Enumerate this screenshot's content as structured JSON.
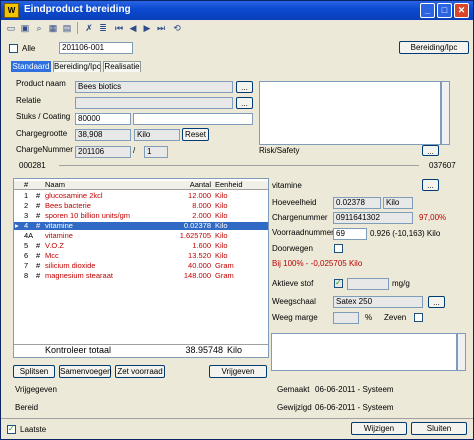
{
  "window": {
    "title": "Eindproduct bereiding"
  },
  "top": {
    "alle_label": "Alle",
    "batch_code": "201106-001",
    "bereiding_button": "Bereiding/Ipc"
  },
  "tabs": [
    "Standaard",
    "Bereiding/Ipc",
    "Realisatie"
  ],
  "form": {
    "product_label": "Product naam",
    "product_value": "Bees biotics",
    "relatie_label": "Relatie",
    "relatie_value": "",
    "stuks_label": "Stuks / Coating",
    "stuks_value": "80000",
    "stuks_value2": "",
    "chargegrootte_label": "Chargegrootte",
    "chargegrootte_value": "38,908",
    "chargegrootte_unit": "Kilo",
    "reset_button": "Reset",
    "chargenummer_label": "ChargeNummer",
    "chargenummer_value": "201106",
    "chargenummer_sep": "/",
    "chargenummer_sub": "1",
    "risk_label": "Risk/Safety",
    "code_left": "000281",
    "code_right": "037607",
    "more_button": "..."
  },
  "grid": {
    "headers": [
      "#",
      "Naam",
      "Aantal",
      "Eenheid"
    ],
    "rows": [
      {
        "marker": "",
        "nr": "1",
        "hash": "#",
        "naam": "glucosamine 2kcl",
        "aantal": "12.000",
        "eenheid": "Kilo"
      },
      {
        "marker": "",
        "nr": "2",
        "hash": "#",
        "naam": "Bees bacterie",
        "aantal": "8.000",
        "eenheid": "Kilo"
      },
      {
        "marker": "",
        "nr": "3",
        "hash": "#",
        "naam": "sporen 10 billion units/gm",
        "aantal": "2.000",
        "eenheid": "Kilo"
      },
      {
        "marker": "▸",
        "nr": "4",
        "hash": "#",
        "naam": "vitamine",
        "aantal": "0.02378",
        "eenheid": "Kilo"
      },
      {
        "marker": "",
        "nr": "4A",
        "hash": "",
        "naam": "vitamine",
        "aantal": "1.625705",
        "eenheid": "Kilo"
      },
      {
        "marker": "",
        "nr": "5",
        "hash": "#",
        "naam": "V.O.Z",
        "aantal": "1.600",
        "eenheid": "Kilo"
      },
      {
        "marker": "",
        "nr": "6",
        "hash": "#",
        "naam": "Mcc",
        "aantal": "13.520",
        "eenheid": "Kilo"
      },
      {
        "marker": "",
        "nr": "7",
        "hash": "#",
        "naam": "silicium dioxide",
        "aantal": "40.000",
        "eenheid": "Gram"
      },
      {
        "marker": "",
        "nr": "8",
        "hash": "#",
        "naam": "magnesium stearaat",
        "aantal": "148.000",
        "eenheid": "Gram"
      }
    ],
    "footer_label": "Kontroleer totaal",
    "footer_total": "38.95748",
    "footer_unit": "Kilo"
  },
  "detail": {
    "name": "vitamine",
    "more": "...",
    "hoeveelheid_label": "Hoeveelheid",
    "hoeveelheid_value": "0.02378",
    "hoeveelheid_unit": "Kilo",
    "chargenummer_label": "Chargenummer",
    "chargenummer_value": "0911641302",
    "chargenummer_pct": "97,00%",
    "voorraad_label": "Voorraadnummer",
    "voorraad_value": "69",
    "voorraad_info": "0.926 (-10,163) Kilo",
    "doorwegen_label": "Doorwegen",
    "bij_text": "Bij 100% - -0,025705 Kilo",
    "stof_label": "Aktieve stof",
    "stof_unit": "mg/g",
    "weegschaal_label": "Weegschaal",
    "weegschaal_value": "Satex 250",
    "marge_label": "Weeg marge",
    "marge_unit": "%",
    "zeven_label": "Zeven"
  },
  "actions": {
    "splitsen": "Splitsen",
    "samenvoegen": "Samenvoegen",
    "zet_voorraad": "Zet voorraad",
    "vrijgeven": "Vrijgeven"
  },
  "status": {
    "vrijgegeven_label": "Vrijgegeven",
    "bereid_label": "Bereid",
    "gemaakt_label": "Gemaakt",
    "gemaakt_value": "06-06-2011 - Systeem",
    "gewijzigd_label": "Gewijzigd",
    "gewijzigd_value": "06-06-2011 - Systeem"
  },
  "bottom": {
    "laatste_label": "Laatste",
    "wijzigen": "Wijzigen",
    "sluiten": "Sluiten"
  }
}
